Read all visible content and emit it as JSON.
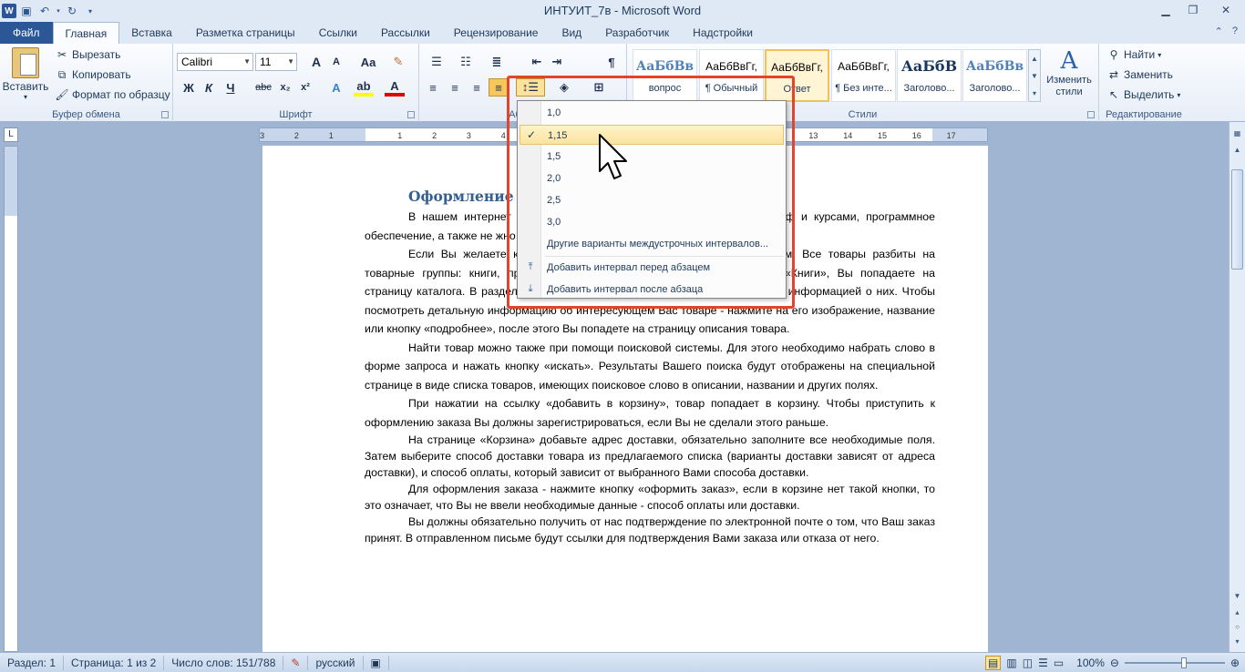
{
  "window": {
    "title": "ИНТУИТ_7в - Microsoft Word",
    "app_icon": "W"
  },
  "tabs": [
    "Файл",
    "Главная",
    "Вставка",
    "Разметка страницы",
    "Ссылки",
    "Рассылки",
    "Рецензирование",
    "Вид",
    "Разработчик",
    "Надстройки"
  ],
  "active_tab": "Главная",
  "ribbon": {
    "clipboard": {
      "paste": "Вставить",
      "cut": "Вырезать",
      "copy": "Копировать",
      "format_painter": "Формат по образцу",
      "label": "Буфер обмена"
    },
    "font": {
      "font_name": "Calibri",
      "font_size": "11",
      "label": "Шрифт",
      "bold": "Ж",
      "italic": "К",
      "underline": "Ч",
      "strike": "abc",
      "subscript": "x₂",
      "superscript": "x²",
      "grow": "A",
      "shrink": "A",
      "change_case": "Aa"
    },
    "paragraph": {
      "label": "Абзац"
    },
    "styles": {
      "items": [
        {
          "sample": "АаБбВв",
          "name": "вопрос"
        },
        {
          "sample": "АаБбВвГг,",
          "name": "¶ Обычный"
        },
        {
          "sample": "АаБбВвГг,",
          "name": "Ответ"
        },
        {
          "sample": "АаБбВвГг,",
          "name": "¶ Без инте..."
        },
        {
          "sample": "АаБбВ",
          "name": "Заголово..."
        },
        {
          "sample": "АаБбВв",
          "name": "Заголово..."
        }
      ],
      "change_styles": "Изменить стили",
      "label": "Стили"
    },
    "editing": {
      "find": "Найти",
      "replace": "Заменить",
      "select": "Выделить",
      "label": "Редактирование"
    }
  },
  "line_spacing_menu": {
    "options": [
      "1,0",
      "1,15",
      "1,5",
      "2,0",
      "2,5",
      "3,0"
    ],
    "checked": "1,15",
    "more": "Другие варианты междустрочных интервалов...",
    "add_before": "Добавить интервал перед абзацем",
    "add_after": "Добавить интервал после абзаца"
  },
  "ruler": {
    "marks": [
      "3",
      "2",
      "1",
      "1",
      "2",
      "3",
      "4",
      "5",
      "6",
      "7",
      "8",
      "9",
      "10",
      "11",
      "12",
      "13",
      "14",
      "15",
      "16",
      "17"
    ]
  },
  "document": {
    "heading": "Оформление",
    "paragraphs": [
      "В нашем интернет                                                         енные издательством Интернет-Университета Инф                                                         и курсами, программное обеспечение, а также не                                                         жно оформить заказы на загрузку учебных курсов с",
      "Если Вы желаете к                                                         стой способ - воспользуйтесь нашим каталогом. Все товары разбиты на товарные группы: книги, программы: Выбрав товарную группу, например «Книги», Вы попадаете на страницу каталога. В разделе каталога представлен список товаров с краткой информацией о них. Чтобы посмотреть детальную информацию об интересующем Вас товаре - нажмите на его изображение, название или кнопку «подробнее», после этого Вы попадете на страницу описания товара.",
      "Найти товар можно также при помощи поисковой системы. Для этого необходимо набрать слово в форме запроса и нажать кнопку «искать». Результаты Вашего поиска будут отображены на специальной странице в виде списка товаров, имеющих поисковое слово в описании, названии и других полях.",
      "При нажатии на ссылку «добавить в корзину», товар попадает в корзину. Чтобы приступить к оформлению заказа Вы должны зарегистрироваться, если Вы не сделали этого раньше.",
      "На странице «Корзина» добавьте адрес доставки, обязательно заполните все необходимые поля. Затем выберите способ доставки товара из предлагаемого списка (варианты доставки зависят от адреса доставки), и способ оплаты, который зависит от выбранного Вами способа доставки.",
      "Для оформления заказа - нажмите кнопку «оформить заказ», если в корзине нет такой кнопки, то это означает, что Вы не ввели необходимые данные - способ оплаты или доставки.",
      "Вы должны обязательно получить от нас подтверждение по электронной почте о том, что Ваш заказ принят. В отправленном письме будут ссылки для подтверждения Вами заказа или отказа от него."
    ]
  },
  "status": {
    "section": "Раздел: 1",
    "page": "Страница: 1 из 2",
    "words": "Число слов: 151/788",
    "language": "русский",
    "zoom": "100%"
  },
  "colors": {
    "highlight_box": "#e6432d",
    "file_tab": "#2b5797"
  }
}
